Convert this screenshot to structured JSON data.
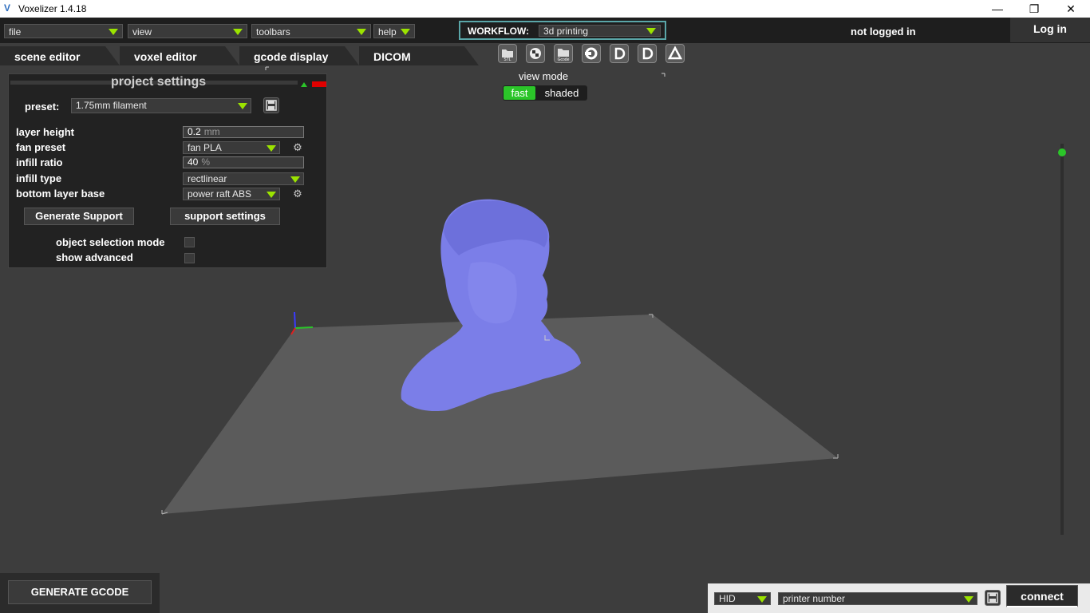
{
  "window": {
    "title": "Voxelizer 1.4.18",
    "logo_letter": "V",
    "minimize": "—",
    "maximize": "❐",
    "close": "✕"
  },
  "menubar": {
    "file": "file",
    "view": "view",
    "toolbars": "toolbars",
    "help": "help",
    "workflow_label": "WORKFLOW:",
    "workflow_value": "3d printing",
    "login_status": "not logged in",
    "login_button": "Log in"
  },
  "tabs": [
    {
      "label": "scene editor"
    },
    {
      "label": "voxel editor"
    },
    {
      "label": "gcode display"
    },
    {
      "label": "DICOM"
    }
  ],
  "toolbar": {
    "stl_label": "STL",
    "gcode_label": "Gcode"
  },
  "view_mode": {
    "label": "view mode",
    "fast": "fast",
    "shaded": "shaded",
    "selected": "fast"
  },
  "project_settings": {
    "title": "project settings",
    "preset_label": "preset:",
    "preset_value": "1.75mm filament",
    "layer_height_label": "layer height",
    "layer_height_value": "0.2",
    "layer_height_unit": "mm",
    "fan_preset_label": "fan preset",
    "fan_preset_value": "fan PLA",
    "infill_ratio_label": "infill ratio",
    "infill_ratio_value": "40",
    "infill_ratio_unit": "%",
    "infill_type_label": "infill type",
    "infill_type_value": "rectlinear",
    "bottom_layer_label": "bottom layer base",
    "bottom_layer_value": "power raft ABS",
    "generate_support": "Generate Support",
    "support_settings": "support settings",
    "object_selection_label": "object selection mode",
    "show_advanced_label": "show advanced"
  },
  "bottom": {
    "generate_gcode": "GENERATE GCODE",
    "port_value": "HID",
    "printer_value": "printer number",
    "connect": "connect"
  },
  "colors": {
    "accent_green": "#9be300",
    "model_color": "#7b7ee8",
    "bed_color": "#5b5b5b",
    "viewport_bg": "#3d3d3d"
  }
}
